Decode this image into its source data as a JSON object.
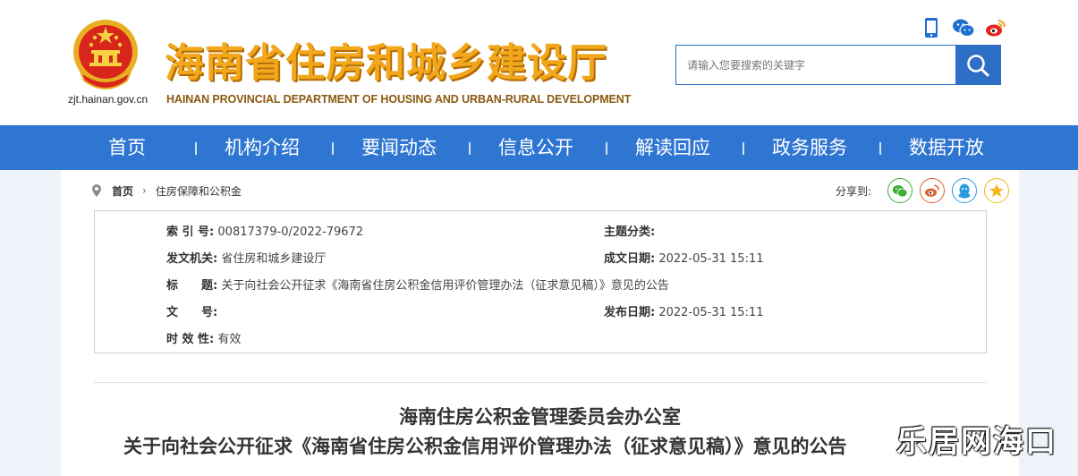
{
  "header": {
    "domain": "zjt.hainan.gov.cn",
    "title": "海南省住房和城乡建设厅",
    "subtitle": "HAINAN PROVINCIAL DEPARTMENT OF HOUSING AND URBAN-RURAL DEVELOPMENT",
    "icons": [
      "mobile-icon",
      "wechat-icon",
      "weibo-icon"
    ],
    "search": {
      "placeholder": "请输入您要搜索的关键字",
      "value": ""
    }
  },
  "nav": {
    "items": [
      {
        "label": "首页"
      },
      {
        "label": "机构介绍"
      },
      {
        "label": "要闻动态"
      },
      {
        "label": "信息公开"
      },
      {
        "label": "解读回应"
      },
      {
        "label": "政务服务"
      },
      {
        "label": "数据开放"
      }
    ]
  },
  "breadcrumb": {
    "home": "首页",
    "current": "住房保障和公积金"
  },
  "share": {
    "label": "分享到:",
    "targets": [
      "wechat-icon",
      "weibo-icon",
      "qq-icon",
      "qzone-icon"
    ]
  },
  "meta": {
    "index_label": "索 引 号:",
    "index_value": "00817379-0/2022-79672",
    "topic_label": "主题分类:",
    "topic_value": "",
    "issuer_label": "发文机关:",
    "issuer_value": "省住房和城乡建设厅",
    "created_label": "成文日期:",
    "created_value": "2022-05-31 15:11",
    "title_label": "标　　题:",
    "title_value": "关于向社会公开征求《海南省住房公积金信用评价管理办法（征求意见稿）》意见的公告",
    "docno_label": "文　　号:",
    "docno_value": "",
    "published_label": "发布日期:",
    "published_value": "2022-05-31 15:11",
    "validity_label": "时 效 性:",
    "validity_value": "有效"
  },
  "document": {
    "title_line1": "海南住房公积金管理委员会办公室",
    "title_line2": "关于向社会公开征求《海南省住房公积金信用评价管理办法（征求意见稿）》意见的公告"
  },
  "watermark": "乐居网海口",
  "colors": {
    "nav": "#2f76d2",
    "title_orange": "#f2a71b",
    "share_wechat": "#3cb034",
    "share_weibo": "#e0602b",
    "share_qq": "#2b9be0",
    "share_qzone": "#f2b619"
  }
}
